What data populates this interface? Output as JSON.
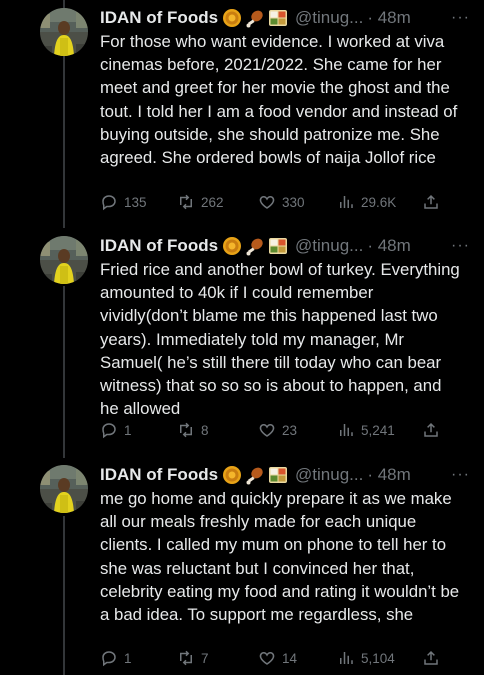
{
  "tweets": [
    {
      "name": "IDAN of Foods",
      "handle": "@tinug...",
      "time": "· 48m",
      "more": "···",
      "text": "For those who want evidence. I worked at viva cinemas before, 2021/2022. She came for her meet and greet for her movie the ghost and the tout. I told her I am a food vendor and instead of buying outside, she should patronize me. She agreed. She ordered bowls of naija Jollof rice",
      "replies": "135",
      "retweets": "262",
      "likes": "330",
      "views": "29.6K"
    },
    {
      "name": "IDAN of Foods",
      "handle": "@tinug...",
      "time": "· 48m",
      "more": "···",
      "text": "Fried rice and another bowl of turkey. Everything amounted to 40k if I could remember vividly(don’t blame me this happened last two years). Immediately told my manager, Mr Samuel( he’s still there till today who can bear witness) that so so so is about to happen, and he allowed",
      "replies": "1",
      "retweets": "8",
      "likes": "23",
      "views": "5,241"
    },
    {
      "name": "IDAN of Foods",
      "handle": "@tinug...",
      "time": "· 48m",
      "more": "···",
      "text": "me go home and quickly prepare it as we make all our meals freshly made for each unique clients. I called my mum on phone to tell her to she was reluctant but I convinced her that, celebrity eating my food and rating it wouldn’t be a bad idea. To support me regardless, she",
      "replies": "1",
      "retweets": "7",
      "likes": "14",
      "views": "5,104"
    }
  ],
  "colors": {
    "background": "#000000",
    "text": "#e7e9ea",
    "muted": "#71767b",
    "thread_line": "#333639"
  },
  "icons": [
    "gold-coin-emoji-icon",
    "drumstick-emoji-icon",
    "bento-box-emoji-icon",
    "reply-icon",
    "retweet-icon",
    "like-icon",
    "views-icon",
    "share-icon"
  ]
}
